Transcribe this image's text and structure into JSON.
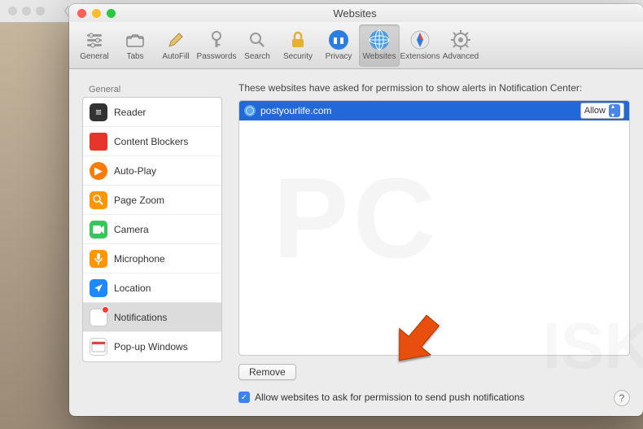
{
  "browser": {
    "plus": "+"
  },
  "window": {
    "title": "Websites"
  },
  "toolbar": {
    "items": [
      {
        "label": "General"
      },
      {
        "label": "Tabs"
      },
      {
        "label": "AutoFill"
      },
      {
        "label": "Passwords"
      },
      {
        "label": "Search"
      },
      {
        "label": "Security"
      },
      {
        "label": "Privacy"
      },
      {
        "label": "Websites"
      },
      {
        "label": "Extensions"
      },
      {
        "label": "Advanced"
      }
    ]
  },
  "sidebar": {
    "header": "General",
    "items": [
      {
        "label": "Reader"
      },
      {
        "label": "Content Blockers"
      },
      {
        "label": "Auto-Play"
      },
      {
        "label": "Page Zoom"
      },
      {
        "label": "Camera"
      },
      {
        "label": "Microphone"
      },
      {
        "label": "Location"
      },
      {
        "label": "Notifications"
      },
      {
        "label": "Pop-up Windows"
      }
    ]
  },
  "main": {
    "instruction": "These websites have asked for permission to show alerts in Notification Center:",
    "site": {
      "name": "postyourlife.com",
      "permission": "Allow"
    },
    "remove_label": "Remove",
    "checkbox_label": "Allow websites to ask for permission to send push notifications",
    "help": "?"
  }
}
